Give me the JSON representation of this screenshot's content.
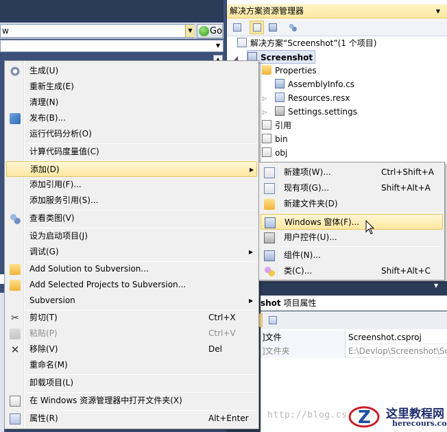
{
  "address_bar": {
    "value": "w",
    "go_label": "Go"
  },
  "solution_explorer": {
    "title": "解决方案资源管理器",
    "tree": [
      {
        "label": "解决方案“Screenshot”(1 个项目)"
      },
      {
        "label": "Screenshot"
      },
      {
        "label": "Properties"
      },
      {
        "label": "AssemblyInfo.cs"
      },
      {
        "label": "Resources.resx"
      },
      {
        "label": "Settings.settings"
      },
      {
        "label": "引用"
      },
      {
        "label": "bin"
      },
      {
        "label": "obj"
      }
    ]
  },
  "properties_panel": {
    "header_bold": "shot",
    "header_rest": " 项目属性",
    "rows": [
      {
        "name": "]文件",
        "value": "Screenshot.csproj"
      },
      {
        "name": "]文件夹",
        "value": "E:\\Devlop\\Screenshot\\Scr"
      }
    ]
  },
  "context_menu": {
    "items": [
      {
        "label": "生成(U)",
        "icon": "build-icon"
      },
      {
        "label": "重新生成(E)"
      },
      {
        "label": "清理(N)"
      },
      {
        "label": "发布(B)...",
        "icon": "publish-icon"
      },
      {
        "label": "运行代码分析(O)"
      },
      {
        "label": "计算代码度量值(C)"
      },
      {
        "label": "添加(D)"
      },
      {
        "label": "添加引用(F)..."
      },
      {
        "label": "添加服务引用(S)..."
      },
      {
        "label": "查看类图(V)",
        "icon": "class-diagram-icon"
      },
      {
        "label": "设为启动项目(J)"
      },
      {
        "label": "调试(G)"
      },
      {
        "label": "Add Solution to Subversion...",
        "icon": "folder-add-icon"
      },
      {
        "label": "Add Selected Projects to Subversion...",
        "icon": "folder-add-icon"
      },
      {
        "label": "Subversion"
      },
      {
        "label": "剪切(T)",
        "shortcut": "Ctrl+X",
        "icon": "cut-icon"
      },
      {
        "label": "粘贴(P)",
        "shortcut": "Ctrl+V",
        "icon": "paste-icon"
      },
      {
        "label": "移除(V)",
        "shortcut": "Del",
        "icon": "remove-icon"
      },
      {
        "label": "重命名(M)"
      },
      {
        "label": "卸载项目(L)"
      },
      {
        "label": "在 Windows 资源管理器中打开文件夹(X)",
        "icon": "open-folder-icon"
      },
      {
        "label": "属性(R)",
        "shortcut": "Alt+Enter",
        "icon": "properties-icon"
      }
    ]
  },
  "submenu": {
    "items": [
      {
        "label": "新建项(W)...",
        "shortcut": "Ctrl+Shift+A",
        "icon": "new-item-icon"
      },
      {
        "label": "现有项(G)...",
        "shortcut": "Shift+Alt+A",
        "icon": "existing-item-icon"
      },
      {
        "label": "新建文件夹(D)",
        "icon": "new-folder-icon"
      },
      {
        "label": "Windows 窗体(F)...",
        "icon": "windows-form-icon"
      },
      {
        "label": "用户控件(U)...",
        "icon": "user-control-icon"
      },
      {
        "label": "组件(N)...",
        "icon": "component-icon"
      },
      {
        "label": "类(C)...",
        "shortcut": "Shift+Alt+C",
        "icon": "class-icon"
      }
    ]
  },
  "watermark": "http://blog.csdn.",
  "logo": {
    "title": "这里教程网",
    "url": "herecours.com"
  }
}
